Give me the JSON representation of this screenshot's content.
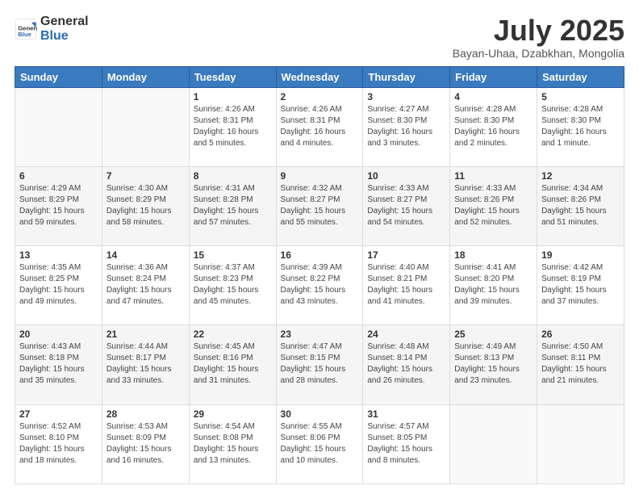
{
  "header": {
    "logo": {
      "text_general": "General",
      "text_blue": "Blue"
    },
    "title": "July 2025",
    "subtitle": "Bayan-Uhaa, Dzabkhan, Mongolia"
  },
  "weekdays": [
    "Sunday",
    "Monday",
    "Tuesday",
    "Wednesday",
    "Thursday",
    "Friday",
    "Saturday"
  ],
  "weeks": [
    [
      {
        "day": "",
        "info": ""
      },
      {
        "day": "",
        "info": ""
      },
      {
        "day": "1",
        "info": "Sunrise: 4:26 AM\nSunset: 8:31 PM\nDaylight: 16 hours\nand 5 minutes."
      },
      {
        "day": "2",
        "info": "Sunrise: 4:26 AM\nSunset: 8:31 PM\nDaylight: 16 hours\nand 4 minutes."
      },
      {
        "day": "3",
        "info": "Sunrise: 4:27 AM\nSunset: 8:30 PM\nDaylight: 16 hours\nand 3 minutes."
      },
      {
        "day": "4",
        "info": "Sunrise: 4:28 AM\nSunset: 8:30 PM\nDaylight: 16 hours\nand 2 minutes."
      },
      {
        "day": "5",
        "info": "Sunrise: 4:28 AM\nSunset: 8:30 PM\nDaylight: 16 hours\nand 1 minute."
      }
    ],
    [
      {
        "day": "6",
        "info": "Sunrise: 4:29 AM\nSunset: 8:29 PM\nDaylight: 15 hours\nand 59 minutes."
      },
      {
        "day": "7",
        "info": "Sunrise: 4:30 AM\nSunset: 8:29 PM\nDaylight: 15 hours\nand 58 minutes."
      },
      {
        "day": "8",
        "info": "Sunrise: 4:31 AM\nSunset: 8:28 PM\nDaylight: 15 hours\nand 57 minutes."
      },
      {
        "day": "9",
        "info": "Sunrise: 4:32 AM\nSunset: 8:27 PM\nDaylight: 15 hours\nand 55 minutes."
      },
      {
        "day": "10",
        "info": "Sunrise: 4:33 AM\nSunset: 8:27 PM\nDaylight: 15 hours\nand 54 minutes."
      },
      {
        "day": "11",
        "info": "Sunrise: 4:33 AM\nSunset: 8:26 PM\nDaylight: 15 hours\nand 52 minutes."
      },
      {
        "day": "12",
        "info": "Sunrise: 4:34 AM\nSunset: 8:26 PM\nDaylight: 15 hours\nand 51 minutes."
      }
    ],
    [
      {
        "day": "13",
        "info": "Sunrise: 4:35 AM\nSunset: 8:25 PM\nDaylight: 15 hours\nand 49 minutes."
      },
      {
        "day": "14",
        "info": "Sunrise: 4:36 AM\nSunset: 8:24 PM\nDaylight: 15 hours\nand 47 minutes."
      },
      {
        "day": "15",
        "info": "Sunrise: 4:37 AM\nSunset: 8:23 PM\nDaylight: 15 hours\nand 45 minutes."
      },
      {
        "day": "16",
        "info": "Sunrise: 4:39 AM\nSunset: 8:22 PM\nDaylight: 15 hours\nand 43 minutes."
      },
      {
        "day": "17",
        "info": "Sunrise: 4:40 AM\nSunset: 8:21 PM\nDaylight: 15 hours\nand 41 minutes."
      },
      {
        "day": "18",
        "info": "Sunrise: 4:41 AM\nSunset: 8:20 PM\nDaylight: 15 hours\nand 39 minutes."
      },
      {
        "day": "19",
        "info": "Sunrise: 4:42 AM\nSunset: 8:19 PM\nDaylight: 15 hours\nand 37 minutes."
      }
    ],
    [
      {
        "day": "20",
        "info": "Sunrise: 4:43 AM\nSunset: 8:18 PM\nDaylight: 15 hours\nand 35 minutes."
      },
      {
        "day": "21",
        "info": "Sunrise: 4:44 AM\nSunset: 8:17 PM\nDaylight: 15 hours\nand 33 minutes."
      },
      {
        "day": "22",
        "info": "Sunrise: 4:45 AM\nSunset: 8:16 PM\nDaylight: 15 hours\nand 31 minutes."
      },
      {
        "day": "23",
        "info": "Sunrise: 4:47 AM\nSunset: 8:15 PM\nDaylight: 15 hours\nand 28 minutes."
      },
      {
        "day": "24",
        "info": "Sunrise: 4:48 AM\nSunset: 8:14 PM\nDaylight: 15 hours\nand 26 minutes."
      },
      {
        "day": "25",
        "info": "Sunrise: 4:49 AM\nSunset: 8:13 PM\nDaylight: 15 hours\nand 23 minutes."
      },
      {
        "day": "26",
        "info": "Sunrise: 4:50 AM\nSunset: 8:11 PM\nDaylight: 15 hours\nand 21 minutes."
      }
    ],
    [
      {
        "day": "27",
        "info": "Sunrise: 4:52 AM\nSunset: 8:10 PM\nDaylight: 15 hours\nand 18 minutes."
      },
      {
        "day": "28",
        "info": "Sunrise: 4:53 AM\nSunset: 8:09 PM\nDaylight: 15 hours\nand 16 minutes."
      },
      {
        "day": "29",
        "info": "Sunrise: 4:54 AM\nSunset: 8:08 PM\nDaylight: 15 hours\nand 13 minutes."
      },
      {
        "day": "30",
        "info": "Sunrise: 4:55 AM\nSunset: 8:06 PM\nDaylight: 15 hours\nand 10 minutes."
      },
      {
        "day": "31",
        "info": "Sunrise: 4:57 AM\nSunset: 8:05 PM\nDaylight: 15 hours\nand 8 minutes."
      },
      {
        "day": "",
        "info": ""
      },
      {
        "day": "",
        "info": ""
      }
    ]
  ]
}
